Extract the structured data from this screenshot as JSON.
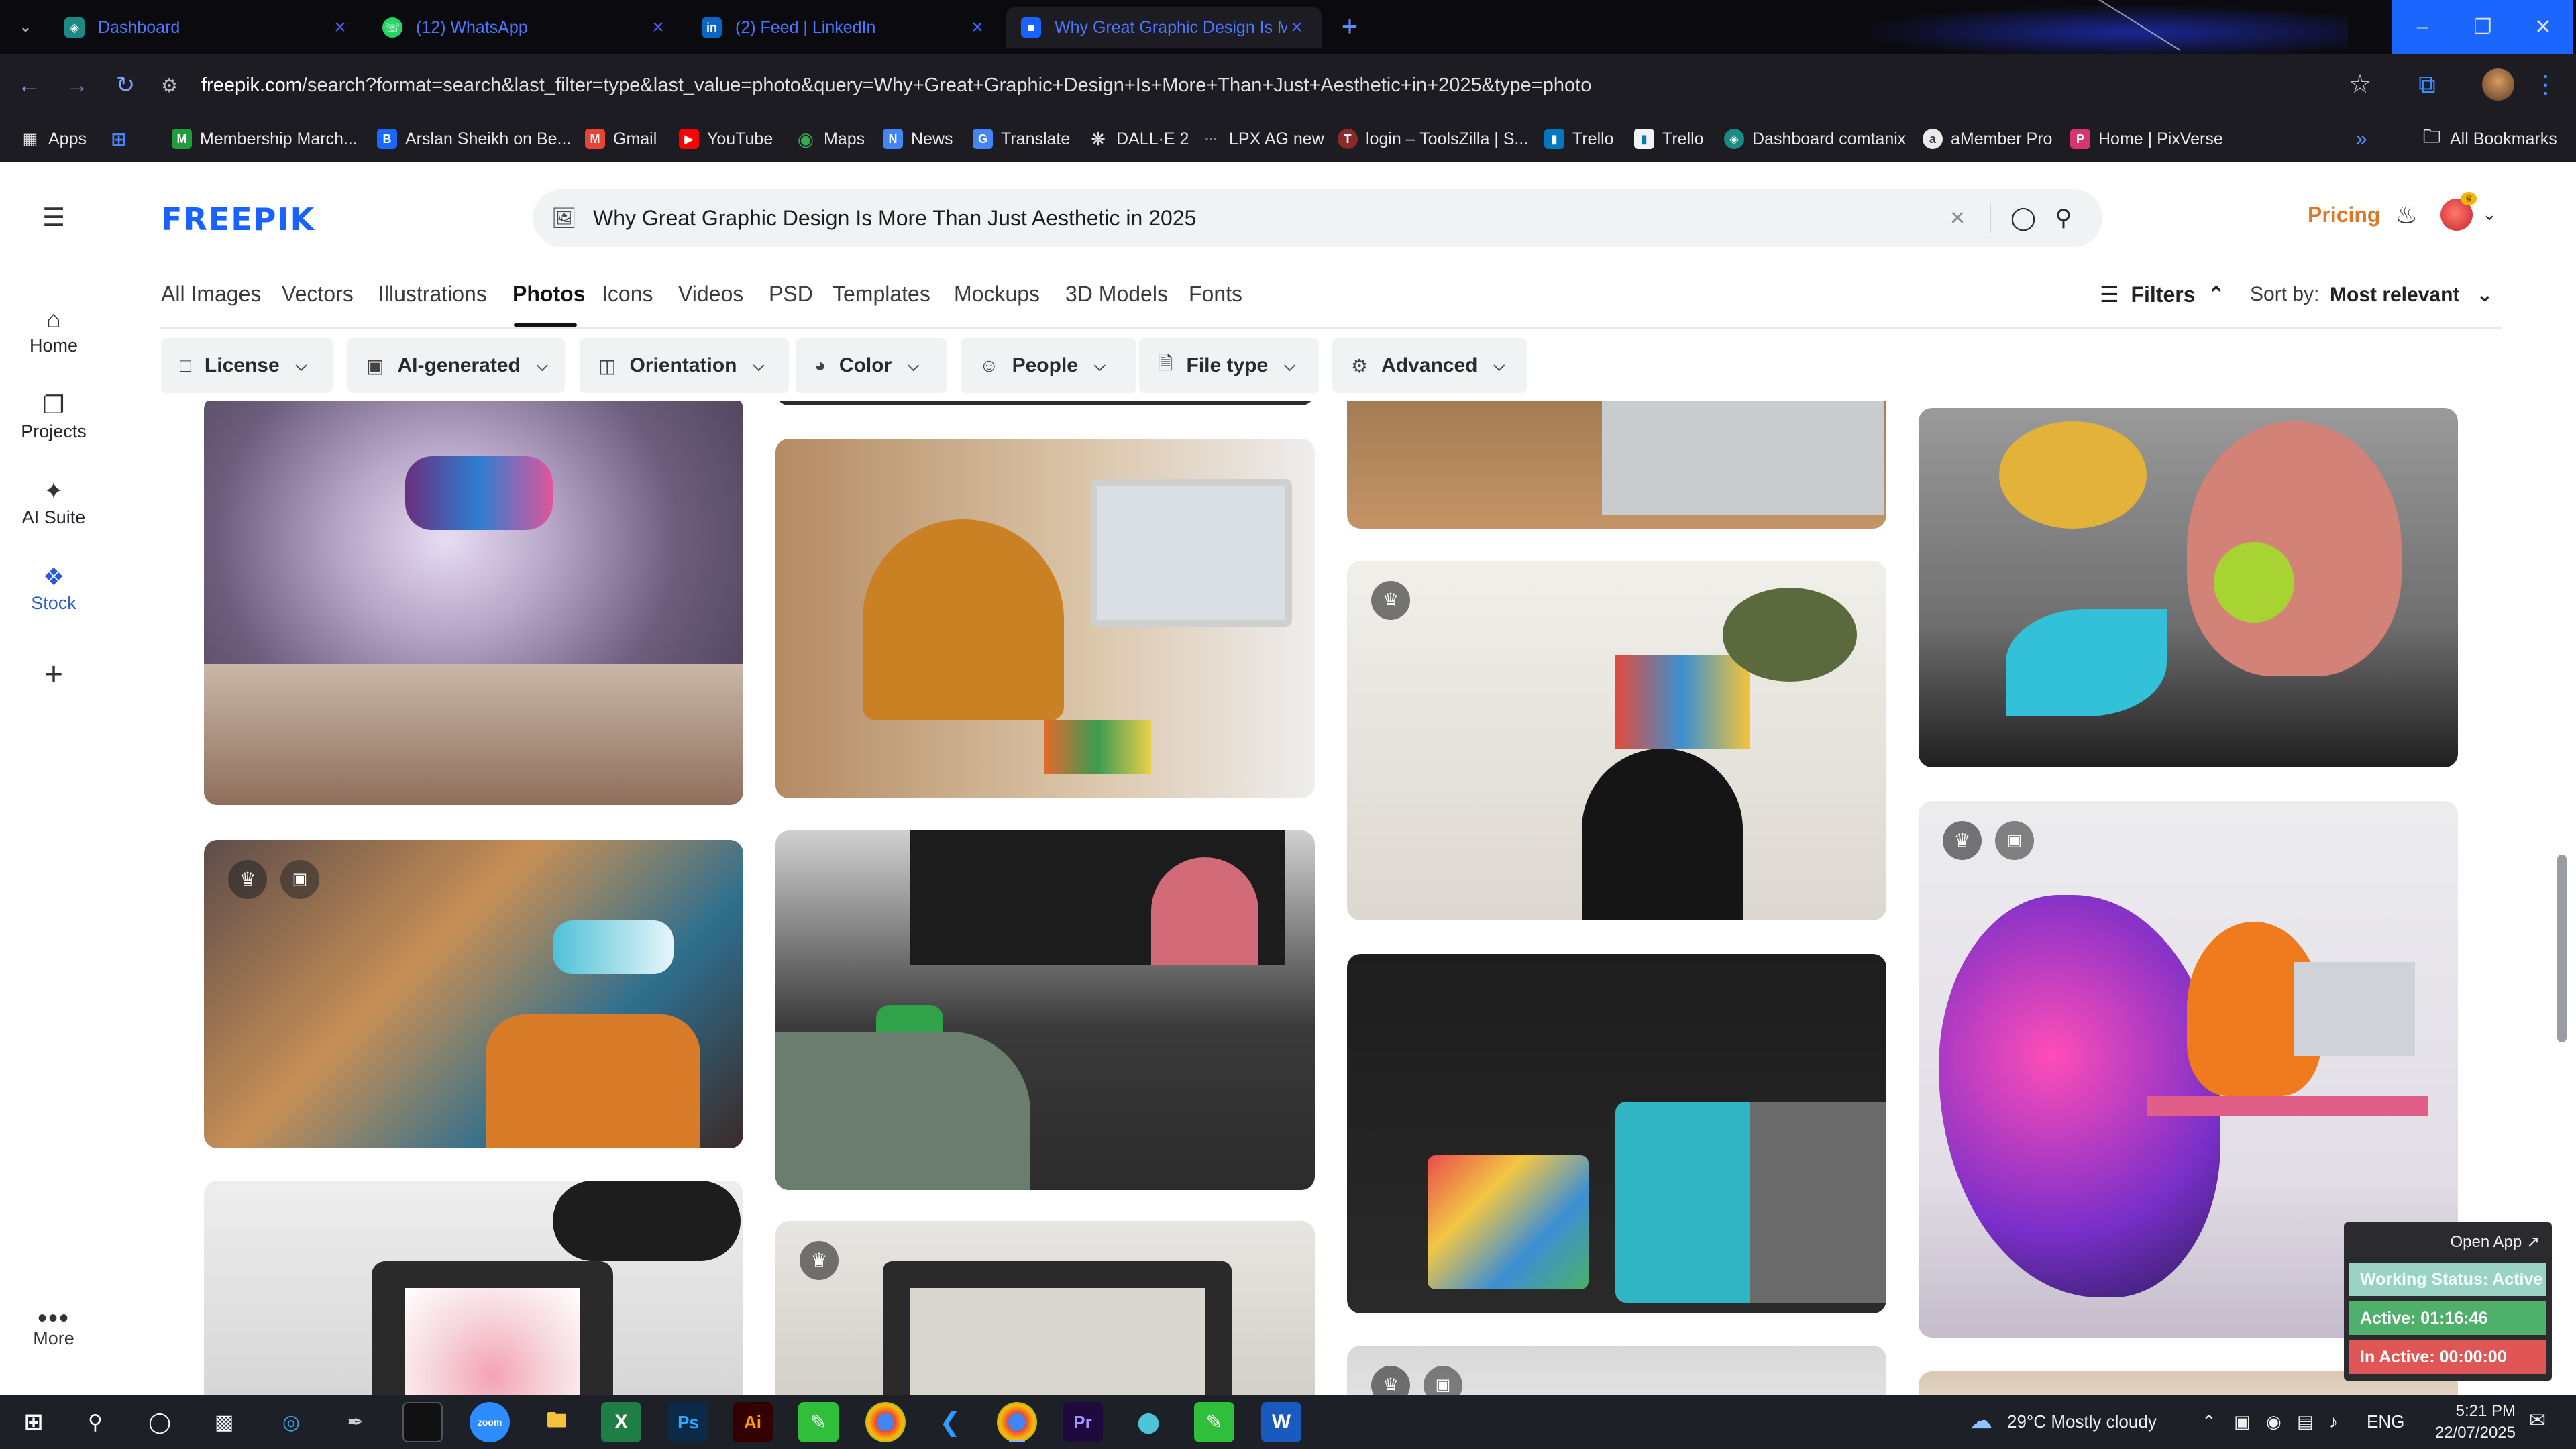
{
  "browser": {
    "tabs": [
      {
        "title": "Dashboard",
        "icon": "dashboard-favicon",
        "active": false
      },
      {
        "title": "(12) WhatsApp",
        "icon": "whatsapp-favicon",
        "active": false
      },
      {
        "title": "(2) Feed | LinkedIn",
        "icon": "linkedin-favicon",
        "active": false
      },
      {
        "title": "Why Great Graphic Design Is M",
        "icon": "freepik-favicon",
        "active": true
      }
    ],
    "url_domain": "freepik.com",
    "url_rest": "/search?format=search&last_filter=type&last_value=photo&query=Why+Great+Graphic+Design+Is+More+Than+Just+Aesthetic+in+2025&type=photo",
    "bookmarks": [
      "Apps",
      "Membership March...",
      "Arslan Sheikh on Be...",
      "Gmail",
      "YouTube",
      "Maps",
      "News",
      "Translate",
      "DALL·E 2",
      "LPX AG new",
      "login – ToolsZilla | S...",
      "Trello",
      "Trello",
      "Dashboard comtanix",
      "aMember Pro",
      "Home | PixVerse"
    ],
    "all_bookmarks": "All Bookmarks"
  },
  "sidebar": {
    "items": [
      {
        "label": "Home",
        "icon": "home-icon"
      },
      {
        "label": "Projects",
        "icon": "projects-icon"
      },
      {
        "label": "AI Suite",
        "icon": "sparkle-icon"
      },
      {
        "label": "Stock",
        "icon": "stock-icon"
      }
    ],
    "more_label": "More"
  },
  "header": {
    "logo": "FREEPIK",
    "search_query": "Why Great Graphic Design Is More Than Just Aesthetic in 2025",
    "pricing_label": "Pricing"
  },
  "type_tabs": [
    "All Images",
    "Vectors",
    "Illustrations",
    "Photos",
    "Icons",
    "Videos",
    "PSD",
    "Templates",
    "Mockups",
    "3D Models",
    "Fonts"
  ],
  "active_type_tab": "Photos",
  "filters_label": "Filters",
  "sort": {
    "label": "Sort by:",
    "value": "Most relevant"
  },
  "filter_chips": [
    "License",
    "AI-generated",
    "Orientation",
    "Color",
    "People",
    "File type",
    "Advanced"
  ],
  "tracker": {
    "open_label": "Open App ↗",
    "status": "Working Status: Active",
    "active": "Active: 01:16:46",
    "inactive": "In Active: 00:00:00"
  },
  "taskbar": {
    "weather": "29°C  Mostly cloudy",
    "lang": "ENG",
    "time": "5:21 PM",
    "date": "22/07/2025"
  },
  "colors": {
    "brand_blue": "#1862ff",
    "pricing_orange": "#e0782a",
    "chrome_dark": "#1c1c22",
    "tracker_green": "#4fb06c",
    "tracker_red": "#e05656"
  }
}
